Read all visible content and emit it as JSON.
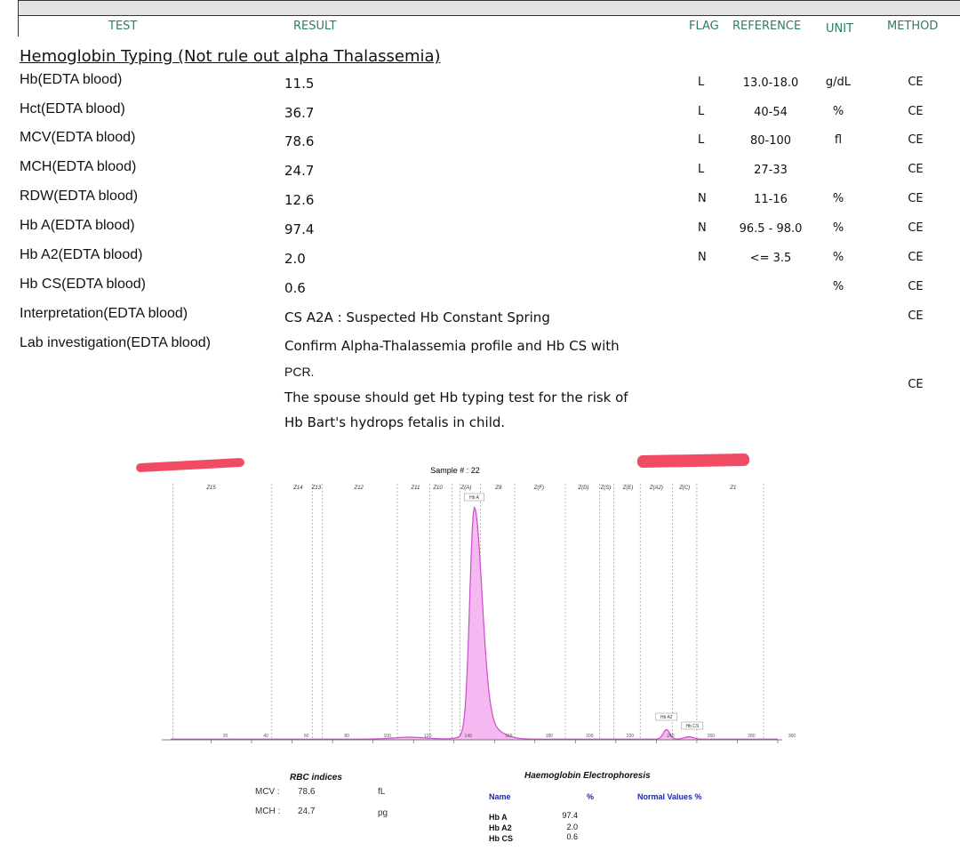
{
  "header": {
    "test": "TEST",
    "result": "RESULT",
    "flag": "FLAG",
    "reference": "REFERENCE",
    "unit": "UNIT",
    "method": "METHOD"
  },
  "section_title": "Hemoglobin Typing (Not rule out alpha Thalassemia)",
  "rows": [
    {
      "test": "Hb(EDTA blood)",
      "result": "11.5",
      "flag": "L",
      "reference": "13.0-18.0",
      "unit": "g/dL",
      "method": "CE"
    },
    {
      "test": "Hct(EDTA blood)",
      "result": "36.7",
      "flag": "L",
      "reference": "40-54",
      "unit": "%",
      "method": "CE"
    },
    {
      "test": "MCV(EDTA blood)",
      "result": "78.6",
      "flag": "L",
      "reference": "80-100",
      "unit": "fl",
      "method": "CE"
    },
    {
      "test": "MCH(EDTA blood)",
      "result": "24.7",
      "flag": "L",
      "reference": "27-33",
      "unit": "",
      "method": "CE"
    },
    {
      "test": "RDW(EDTA blood)",
      "result": "12.6",
      "flag": "N",
      "reference": "11-16",
      "unit": "%",
      "method": "CE"
    },
    {
      "test": "Hb A(EDTA blood)",
      "result": "97.4",
      "flag": "N",
      "reference": "96.5 - 98.0",
      "unit": "%",
      "method": "CE"
    },
    {
      "test": "Hb A2(EDTA blood)",
      "result": "2.0",
      "flag": "N",
      "reference": "<= 3.5",
      "unit": "%",
      "method": "CE"
    },
    {
      "test": "Hb CS(EDTA blood)",
      "result": "0.6",
      "flag": "",
      "reference": "",
      "unit": "%",
      "method": "CE"
    },
    {
      "test": "Interpretation(EDTA blood)",
      "result": "CS A2A : Suspected Hb Constant Spring",
      "flag": "",
      "reference": "",
      "unit": "",
      "method": "CE"
    }
  ],
  "lab_investigation": {
    "test": "Lab investigation(EDTA blood)",
    "lines": [
      "Confirm Alpha-Thalassemia profile and Hb CS with",
      "PCR.",
      "The spouse should get Hb typing test for the risk of",
      "Hb Bart's hydrops fetalis in child."
    ],
    "method": "CE"
  },
  "chart_data": {
    "type": "line",
    "title": "Sample # : 22",
    "xlim": [
      0,
      300
    ],
    "x_ticks": [
      20,
      40,
      60,
      80,
      100,
      120,
      140,
      160,
      180,
      200,
      220,
      240,
      260,
      280,
      300
    ],
    "zones": [
      {
        "label": "Z15",
        "x": 20
      },
      {
        "label": "Z14",
        "x": 63
      },
      {
        "label": "Z13",
        "x": 72
      },
      {
        "label": "Z12",
        "x": 93
      },
      {
        "label": "Z11",
        "x": 121
      },
      {
        "label": "Z10",
        "x": 132
      },
      {
        "label": "Z(A)",
        "x": 146
      },
      {
        "label": "Z8",
        "x": 162
      },
      {
        "label": "Z(F)",
        "x": 182
      },
      {
        "label": "Z(D)",
        "x": 204
      },
      {
        "label": "Z(S)",
        "x": 215
      },
      {
        "label": "Z(E)",
        "x": 226
      },
      {
        "label": "Z(A2)",
        "x": 240
      },
      {
        "label": "Z(C)",
        "x": 254
      },
      {
        "label": "Z1",
        "x": 278
      }
    ],
    "zone_boundaries": [
      1,
      50,
      70,
      75,
      112,
      128,
      139,
      143,
      153,
      170,
      195,
      212,
      219,
      232,
      248,
      260,
      293
    ],
    "peaks": [
      {
        "name": "Hb A",
        "x": 150,
        "height": 0.93
      },
      {
        "name": "Hb A2",
        "x": 245,
        "height": 0.04
      },
      {
        "name": "Hb CS",
        "x": 256,
        "height": 0.01
      }
    ],
    "line_color": "#c94fc9",
    "fill_color": "#f6b8f0"
  },
  "rbc_indices": {
    "title": "RBC indices",
    "items": [
      {
        "label": "MCV :",
        "value": "78.6",
        "unit": "fL"
      },
      {
        "label": "MCH :",
        "value": "24.7",
        "unit": "pg"
      }
    ]
  },
  "electrophoresis": {
    "title": "Haemoglobin Electrophoresis",
    "columns": [
      "Name",
      "%",
      "Normal Values %"
    ],
    "rows": [
      {
        "name": "Hb A",
        "pct": "97.4"
      },
      {
        "name": "Hb A2",
        "pct": "2.0"
      },
      {
        "name": "Hb CS",
        "pct": "0.6"
      }
    ]
  },
  "colors": {
    "header_text": "#2e7d5b",
    "redaction": "#ef4c63",
    "electro_header": "#1c2aa0"
  }
}
